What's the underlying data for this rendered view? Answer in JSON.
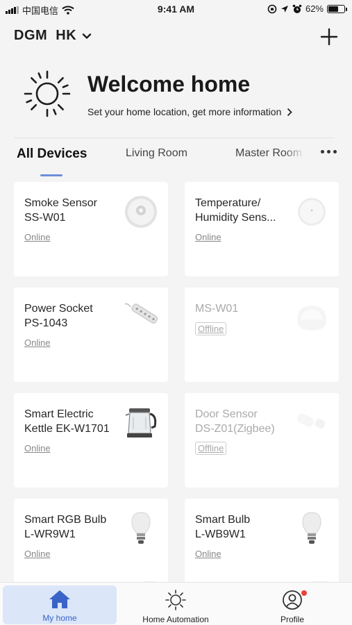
{
  "status_bar": {
    "carrier": "中国电信",
    "time": "9:41 AM",
    "battery": "62%",
    "battery_level": 0.62
  },
  "header": {
    "home_name": "DGM  HK",
    "add_icon": "plus-icon"
  },
  "welcome": {
    "title": "Welcome home",
    "subtitle": "Set your home location, get more information",
    "icon": "sun-icon"
  },
  "tabs": [
    {
      "label": "All Devices",
      "active": true
    },
    {
      "label": "Living Room",
      "active": false
    },
    {
      "label": "Master Room",
      "active": false
    }
  ],
  "devices": [
    {
      "name": "Smoke Sensor\nSS-W01",
      "status": "Online",
      "icon": "smoke-sensor-icon",
      "online": true
    },
    {
      "name": "Temperature/\nHumidity Sens...",
      "status": "Online",
      "icon": "temperature-humidity-sensor-icon",
      "online": true
    },
    {
      "name": "Power Socket\nPS-1043",
      "status": "Online",
      "icon": "power-strip-icon",
      "online": true
    },
    {
      "name": "MS-W01",
      "status": "Offline",
      "icon": "motion-sensor-icon",
      "online": false
    },
    {
      "name": "Smart Electric\nKettle EK-W1701",
      "status": "Online",
      "icon": "kettle-icon",
      "online": true
    },
    {
      "name": "Door Sensor\nDS-Z01(Zigbee)",
      "status": "Offline",
      "icon": "door-sensor-icon",
      "online": false
    },
    {
      "name": "Smart RGB Bulb\nL-WR9W1",
      "status": "Online",
      "icon": "bulb-icon",
      "online": true
    },
    {
      "name": "Smart Bulb\nL-WB9W1",
      "status": "Online",
      "icon": "bulb-icon",
      "online": true
    }
  ],
  "bottom_nav": [
    {
      "label": "My home",
      "icon": "home-icon",
      "active": true
    },
    {
      "label": "Home Automation",
      "icon": "sun-icon",
      "active": false
    },
    {
      "label": "Profile",
      "icon": "profile-icon",
      "active": false
    }
  ],
  "colors": {
    "accent": "#3a64c8",
    "tab_indicator": "#6d8fdc",
    "active_nav_bg": "#dbe6f8",
    "notification_dot": "#e8433a"
  }
}
